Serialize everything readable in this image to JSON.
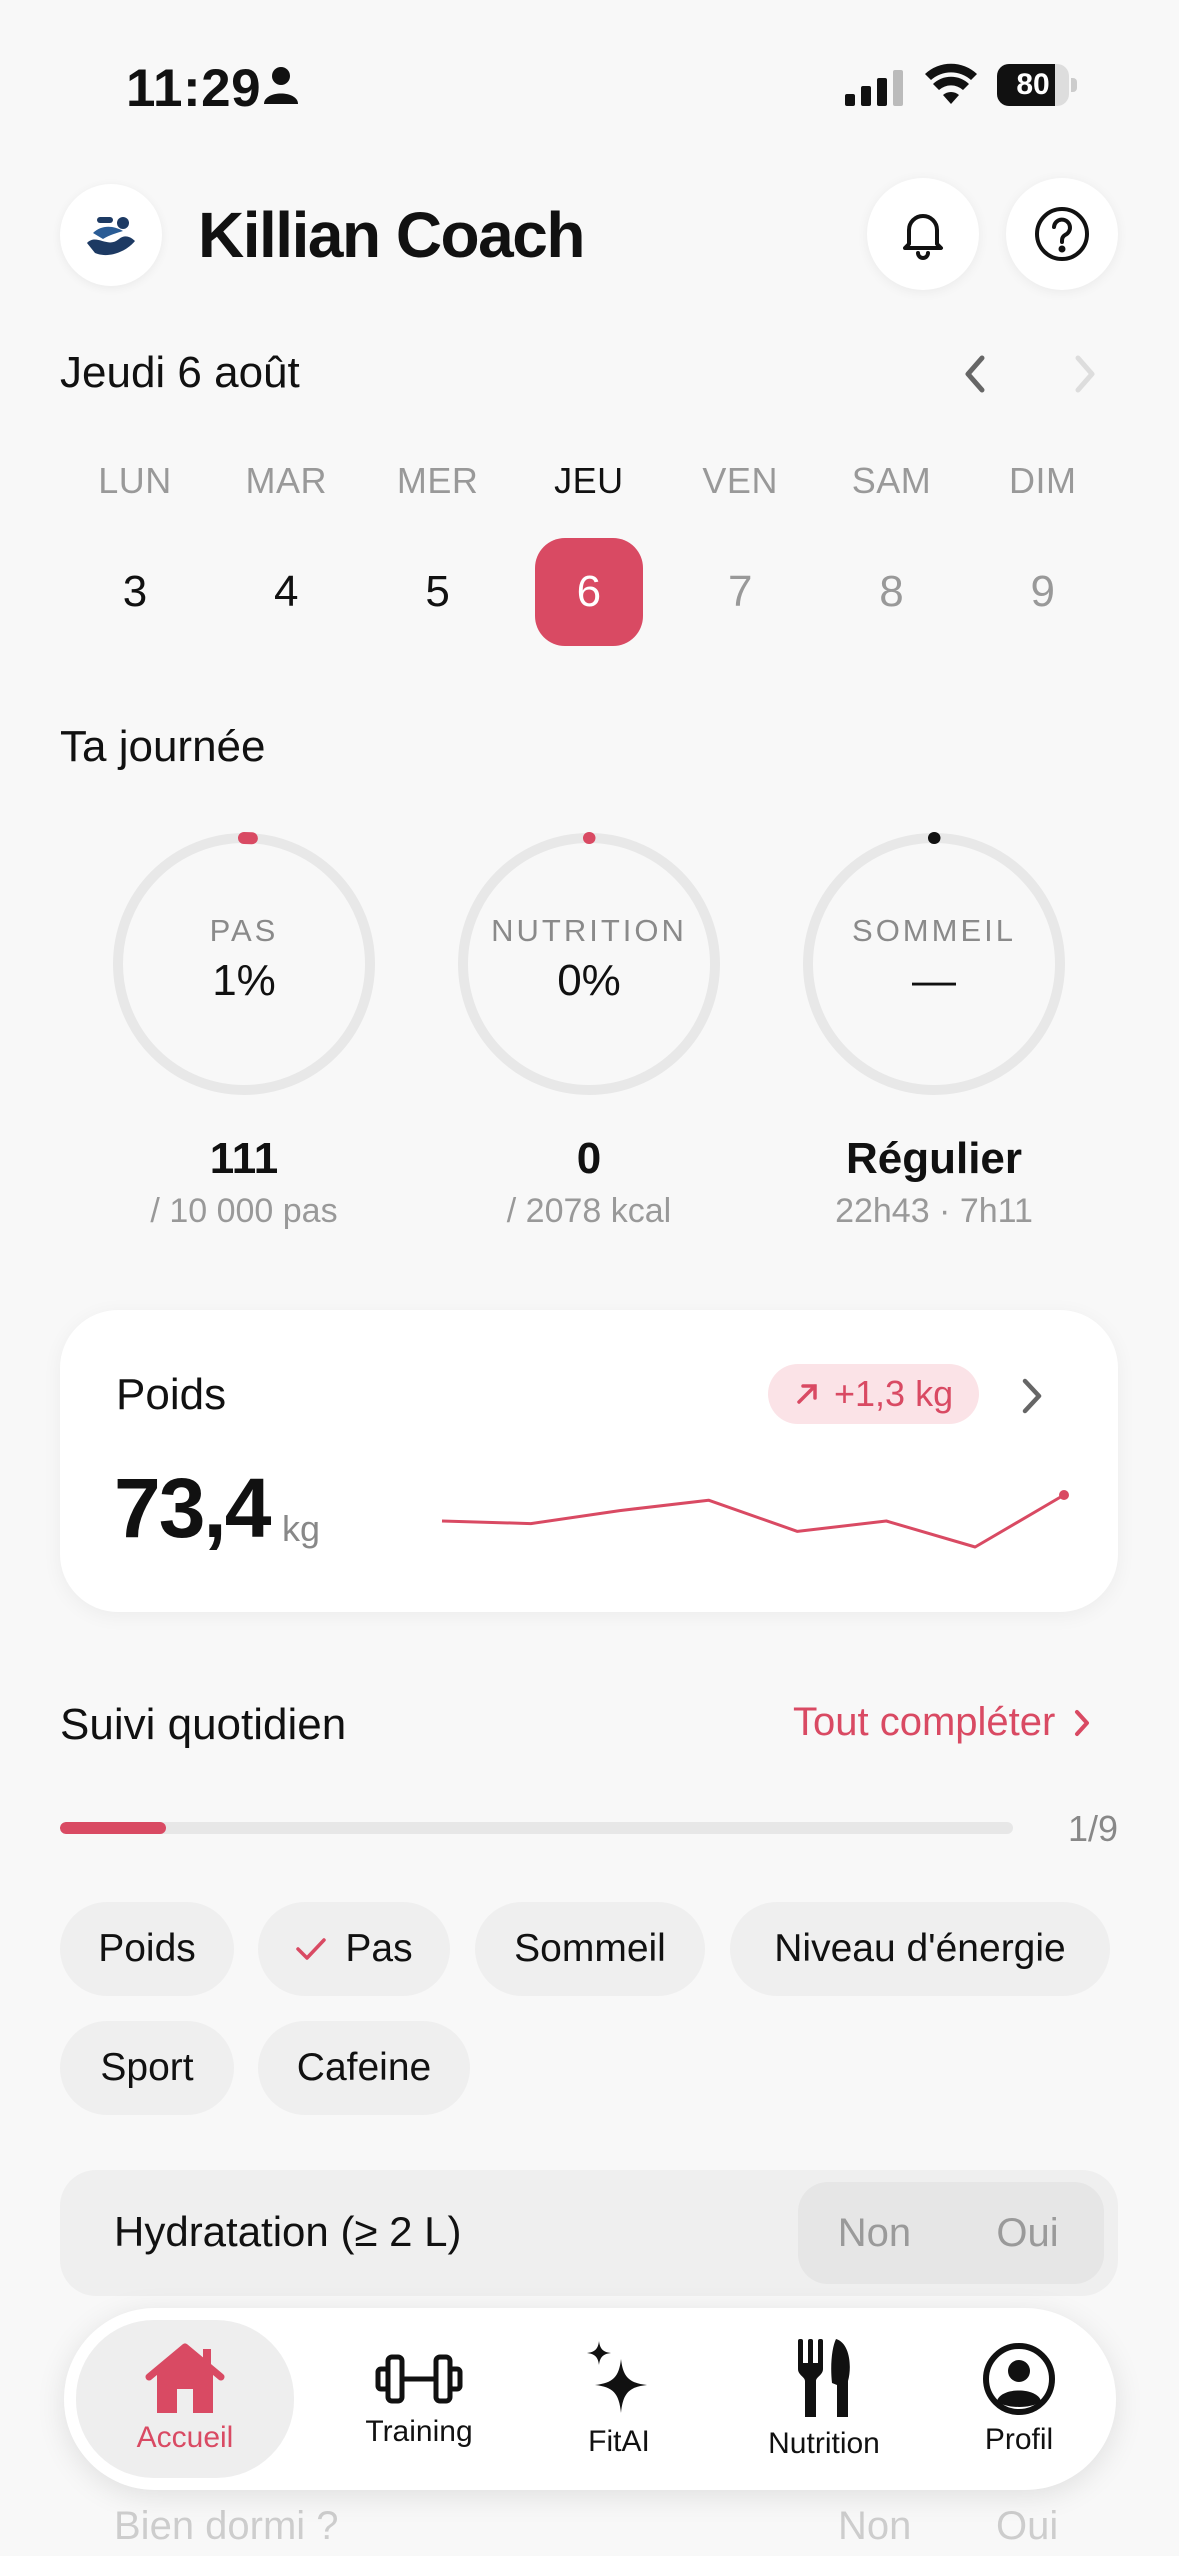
{
  "status_bar": {
    "time": "11:29",
    "battery": "80",
    "battery_level": 0.8
  },
  "header": {
    "title": "Killian Coach"
  },
  "date": {
    "title": "Jeudi 6 août"
  },
  "week": [
    {
      "name": "LUN",
      "num": "3",
      "state": "past"
    },
    {
      "name": "MAR",
      "num": "4",
      "state": "past"
    },
    {
      "name": "MER",
      "num": "5",
      "state": "past"
    },
    {
      "name": "JEU",
      "num": "6",
      "state": "selected"
    },
    {
      "name": "VEN",
      "num": "7",
      "state": "future"
    },
    {
      "name": "SAM",
      "num": "8",
      "state": "future"
    },
    {
      "name": "DIM",
      "num": "9",
      "state": "future"
    }
  ],
  "day_section": {
    "title": "Ta journée",
    "rings": [
      {
        "label": "PAS",
        "value": "1%",
        "main": "111",
        "sub": "/ 10 000 pas",
        "progress": 0.01,
        "color": "#d94a63"
      },
      {
        "label": "NUTRITION",
        "value": "0%",
        "main": "0",
        "sub": "/ 2078 kcal",
        "progress": 0.0,
        "color": "#d94a63"
      },
      {
        "label": "SOMMEIL",
        "value": "—",
        "main": "Régulier",
        "sub": "22h43 · 7h11",
        "progress": 0.0,
        "color": "#111111"
      }
    ]
  },
  "weight_card": {
    "title": "Poids",
    "badge": "+1,3 kg",
    "value": "73,4",
    "unit": "kg",
    "trend": [
      72.9,
      72.85,
      73.1,
      73.3,
      72.7,
      72.9,
      72.4,
      73.4
    ]
  },
  "daily_tracking": {
    "title": "Suivi quotidien",
    "complete_link": "Tout compléter",
    "progress_text": "1/9",
    "progress": 0.111,
    "chips": [
      {
        "label": "Poids",
        "done": false
      },
      {
        "label": "Pas",
        "done": true
      },
      {
        "label": "Sommeil",
        "done": false
      },
      {
        "label": "Niveau d'énergie",
        "done": false
      },
      {
        "label": "Sport",
        "done": false
      },
      {
        "label": "Cafeine",
        "done": false
      }
    ],
    "hydration": {
      "label": "Hydratation (≥ 2 L)",
      "no": "Non",
      "yes": "Oui"
    },
    "below_rows": [
      {
        "label": "Bien dormi ?",
        "no": "Non",
        "yes": "Oui"
      }
    ]
  },
  "tabbar": [
    {
      "label": "Accueil",
      "icon": "home-icon",
      "active": true
    },
    {
      "label": "Training",
      "icon": "dumbbell-icon",
      "active": false
    },
    {
      "label": "FitAI",
      "icon": "sparkles-icon",
      "active": false
    },
    {
      "label": "Nutrition",
      "icon": "fork-knife-icon",
      "active": false
    },
    {
      "label": "Profil",
      "icon": "profile-icon",
      "active": false
    }
  ],
  "colors": {
    "accent": "#d94a63",
    "accent_light": "#fbe3e7",
    "background": "#f8f8f8"
  }
}
